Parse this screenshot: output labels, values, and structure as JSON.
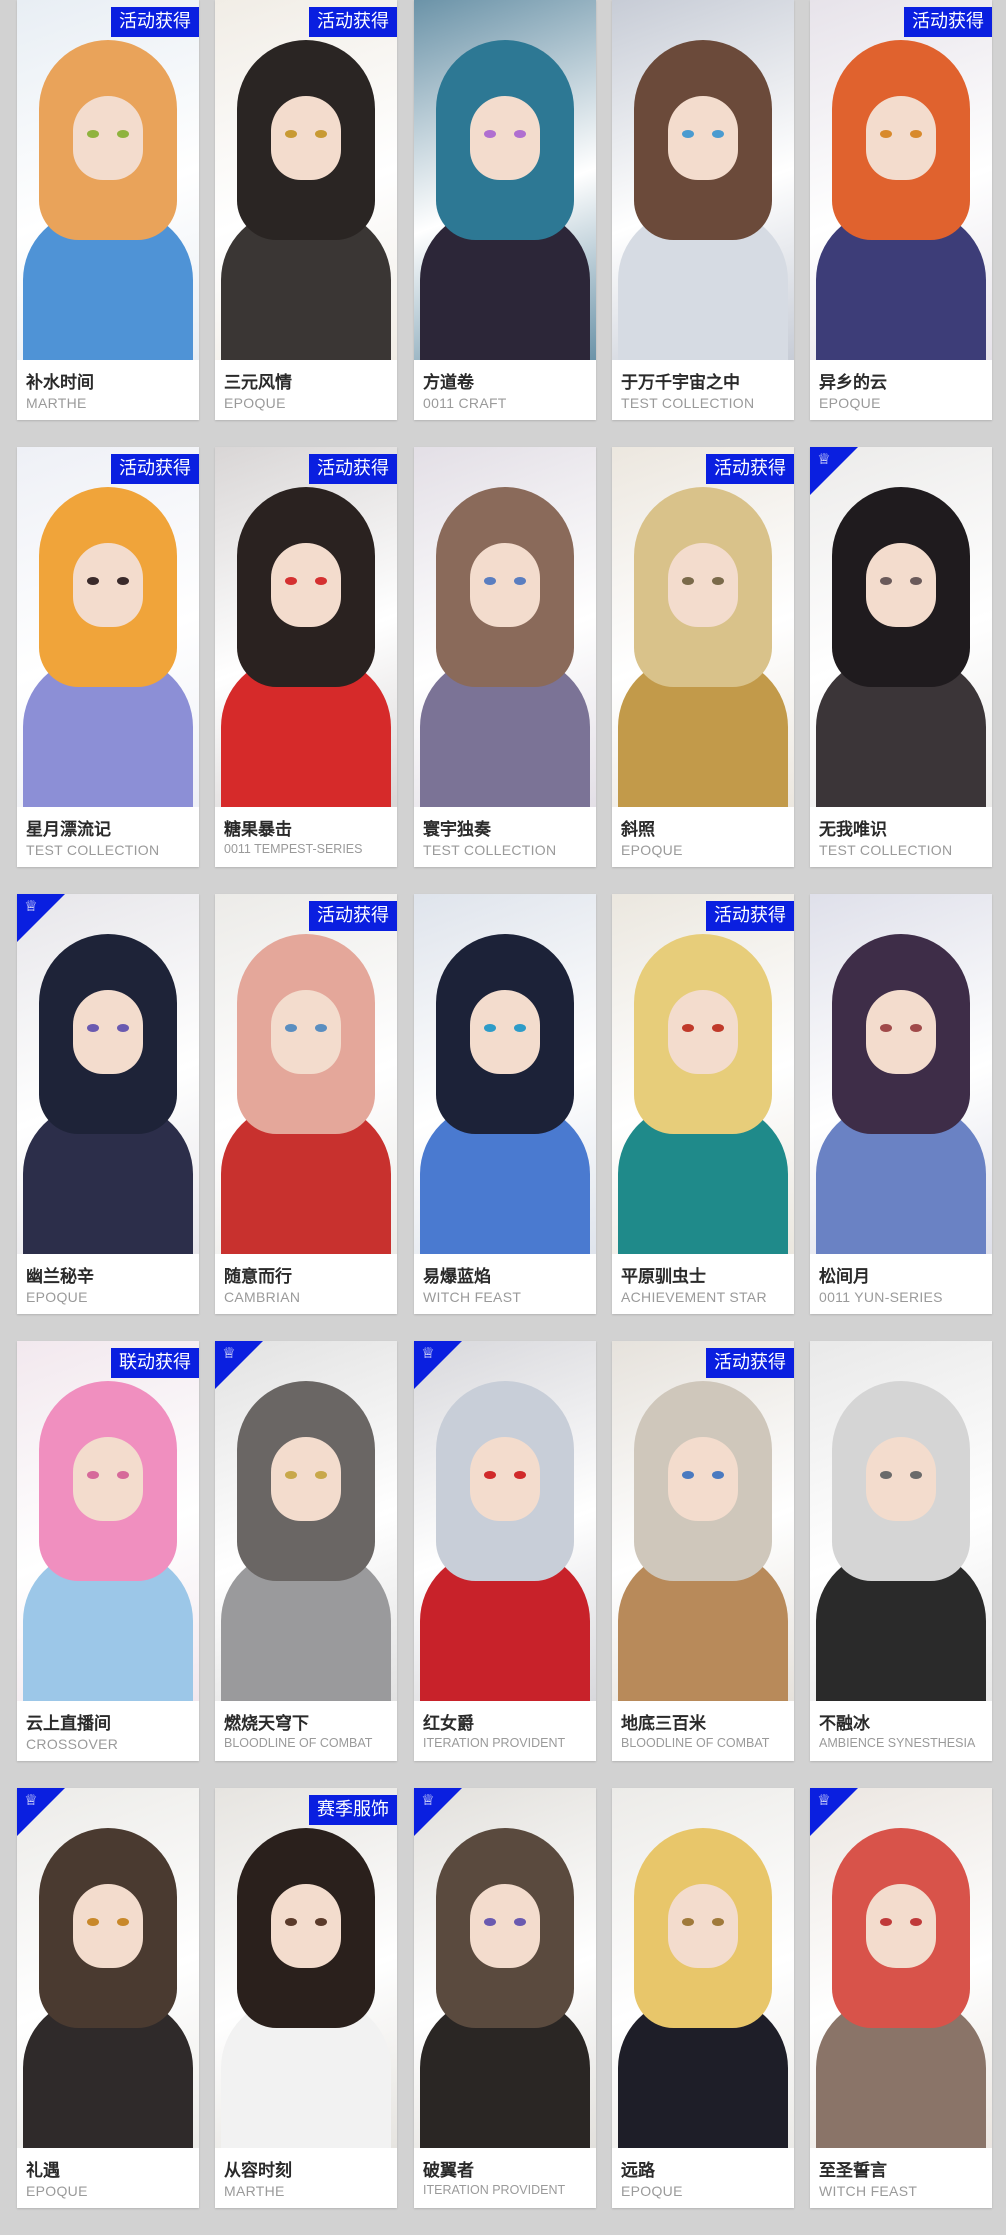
{
  "brand_color": "#0a1fe0",
  "rows": [
    [
      {
        "title": "补水时间",
        "series": "MARTHE",
        "badge": "活动获得",
        "corner": false,
        "palette": {
          "bg": "#e8eef4",
          "hair": "#e9a35a",
          "body": "#4f93d6",
          "eye": "#8fb33e"
        }
      },
      {
        "title": "三元风情",
        "series": "EPOQUE",
        "badge": "活动获得",
        "corner": false,
        "palette": {
          "bg": "#f1ede6",
          "hair": "#2a2523",
          "body": "#3a3634",
          "eye": "#c89a33"
        }
      },
      {
        "title": "方道卷",
        "series": "0011 CRAFT",
        "badge": "",
        "corner": false,
        "palette": {
          "bg": "#6b93a8",
          "hair": "#2d7894",
          "body": "#2c2638",
          "eye": "#b06fd0"
        }
      },
      {
        "title": "于万千宇宙之中",
        "series": "TEST COLLECTION",
        "badge": "",
        "corner": false,
        "palette": {
          "bg": "#c7ccd6",
          "hair": "#6b4a3a",
          "body": "#d6dbe3",
          "eye": "#4a9bd0"
        }
      },
      {
        "title": "异乡的云",
        "series": "EPOQUE",
        "badge": "活动获得",
        "corner": false,
        "palette": {
          "bg": "#e7e3ea",
          "hair": "#e0622e",
          "body": "#3d3d78",
          "eye": "#d88a2c"
        }
      }
    ],
    [
      {
        "title": "星月漂流记",
        "series": "TEST COLLECTION",
        "badge": "活动获得",
        "corner": false,
        "palette": {
          "bg": "#eef0f6",
          "hair": "#f0a43a",
          "body": "#8c8fd6",
          "eye": "#3a2a2a"
        }
      },
      {
        "title": "糖果暴击",
        "series": "0011 TEMPEST-SERIES",
        "badge": "活动获得",
        "corner": false,
        "palette": {
          "bg": "#d9d6d6",
          "hair": "#2a2220",
          "body": "#d62a2a",
          "eye": "#d43030"
        }
      },
      {
        "title": "寰宇独奏",
        "series": "TEST COLLECTION",
        "badge": "",
        "corner": false,
        "palette": {
          "bg": "#e3dfe6",
          "hair": "#8a6a5a",
          "body": "#7b7396",
          "eye": "#5a7ec0"
        }
      },
      {
        "title": "斜照",
        "series": "EPOQUE",
        "badge": "活动获得",
        "corner": false,
        "palette": {
          "bg": "#ece7df",
          "hair": "#d9c28a",
          "body": "#c29a4a",
          "eye": "#7a6a4a"
        }
      },
      {
        "title": "无我唯识",
        "series": "TEST COLLECTION",
        "badge": "",
        "corner": true,
        "palette": {
          "bg": "#ecebea",
          "hair": "#1f1b1e",
          "body": "#3b3538",
          "eye": "#6a5a5a"
        }
      }
    ],
    [
      {
        "title": "幽兰秘辛",
        "series": "EPOQUE",
        "badge": "",
        "corner": true,
        "palette": {
          "bg": "#e7e6ea",
          "hair": "#1e2338",
          "body": "#2c2e4a",
          "eye": "#6a5ab0"
        }
      },
      {
        "title": "随意而行",
        "series": "CAMBRIAN",
        "badge": "活动获得",
        "corner": false,
        "palette": {
          "bg": "#ecebe8",
          "hair": "#e4a79a",
          "body": "#c8312e",
          "eye": "#5a8ec0"
        }
      },
      {
        "title": "易爆蓝焰",
        "series": "WITCH FEAST",
        "badge": "",
        "corner": false,
        "palette": {
          "bg": "#dfe4ec",
          "hair": "#1c2238",
          "body": "#4a7ad0",
          "eye": "#2e9cc8"
        }
      },
      {
        "title": "平原驯虫士",
        "series": "ACHIEVEMENT STAR",
        "badge": "活动获得",
        "corner": false,
        "palette": {
          "bg": "#ebe7df",
          "hair": "#e7cd7a",
          "body": "#1f8a8a",
          "eye": "#c03a2a"
        }
      },
      {
        "title": "松间月",
        "series": "0011 YUN-SERIES",
        "badge": "",
        "corner": false,
        "palette": {
          "bg": "#dfe0ea",
          "hair": "#3e2d48",
          "body": "#6a82c4",
          "eye": "#a04a4a"
        }
      }
    ],
    [
      {
        "title": "云上直播间",
        "series": "CROSSOVER",
        "badge": "联动获得",
        "corner": false,
        "palette": {
          "bg": "#f2e8ee",
          "hair": "#f08fbf",
          "body": "#9cc7e8",
          "eye": "#d66a9a"
        }
      },
      {
        "title": "燃烧天穹下",
        "series": "BLOODLINE OF COMBAT",
        "badge": "",
        "corner": true,
        "palette": {
          "bg": "#e2e2e2",
          "hair": "#6a6664",
          "body": "#9a9a9c",
          "eye": "#c8a84a"
        }
      },
      {
        "title": "红女爵",
        "series": "ITERATION PROVIDENT",
        "badge": "",
        "corner": true,
        "palette": {
          "bg": "#d8d8dc",
          "hair": "#c8ced8",
          "body": "#c8222a",
          "eye": "#d02a2a"
        }
      },
      {
        "title": "地底三百米",
        "series": "BLOODLINE OF COMBAT",
        "badge": "活动获得",
        "corner": false,
        "palette": {
          "bg": "#e6e2dc",
          "hair": "#cfc7bb",
          "body": "#b88a5a",
          "eye": "#4a7ac0"
        }
      },
      {
        "title": "不融冰",
        "series": "AMBIENCE SYNESTHESIA",
        "badge": "",
        "corner": false,
        "palette": {
          "bg": "#e9e9e9",
          "hair": "#d5d5d5",
          "body": "#2a2a2a",
          "eye": "#6a6a6a"
        }
      }
    ],
    [
      {
        "title": "礼遇",
        "series": "EPOQUE",
        "badge": "",
        "corner": true,
        "palette": {
          "bg": "#ecebe8",
          "hair": "#4a3a30",
          "body": "#2f2a2a",
          "eye": "#c8882a"
        }
      },
      {
        "title": "从容时刻",
        "series": "MARTHE",
        "badge": "赛季服饰",
        "corner": false,
        "palette": {
          "bg": "#e6e4e0",
          "hair": "#2a201c",
          "body": "#f2f2f2",
          "eye": "#5a3a2a"
        }
      },
      {
        "title": "破翼者",
        "series": "ITERATION PROVIDENT",
        "badge": "",
        "corner": true,
        "palette": {
          "bg": "#e2e0dc",
          "hair": "#5a4a3e",
          "body": "#2a2624",
          "eye": "#6a5ab0"
        }
      },
      {
        "title": "远路",
        "series": "EPOQUE",
        "badge": "",
        "corner": false,
        "palette": {
          "bg": "#ecebe8",
          "hair": "#e8c66a",
          "body": "#1e1e28",
          "eye": "#a07a3a"
        }
      },
      {
        "title": "至圣誓言",
        "series": "WITCH FEAST",
        "badge": "",
        "corner": true,
        "palette": {
          "bg": "#ebe6e1",
          "hair": "#d8534a",
          "body": "#8a7468",
          "eye": "#c03a3a"
        }
      }
    ]
  ]
}
